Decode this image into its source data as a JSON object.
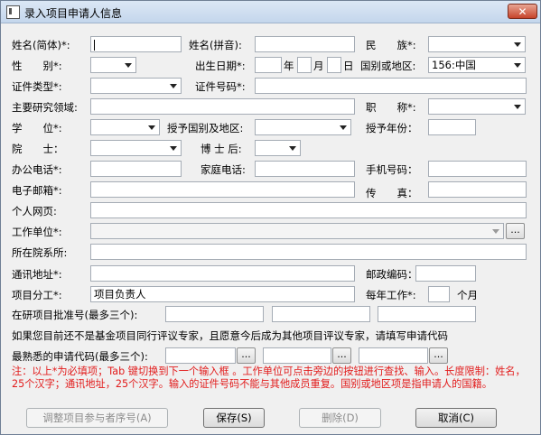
{
  "window": {
    "title": "录入项目申请人信息",
    "close_label": "✕"
  },
  "labels": {
    "name_cn": "姓名(简体)*:",
    "name_py": "姓名(拼音):",
    "nation": "民　　族*:",
    "gender": "性　　别*:",
    "birth": "出生日期*:",
    "year": "年",
    "month": "月",
    "day": "日",
    "country": "国别或地区:",
    "id_type": "证件类型*:",
    "id_no": "证件号码*:",
    "research": "主要研究领域:",
    "title": "职　　称*:",
    "degree": "学　　位*:",
    "degree_country": "授予国别及地区:",
    "degree_year": "授予年份：",
    "academician": "院　　士：",
    "postdoc": "博 士 后:",
    "office_phone": "办公电话*:",
    "home_phone": "家庭电话:",
    "mobile": "手机号码：",
    "email": "电子邮箱*:",
    "fax": "传　　真：",
    "homepage": "个人网页:",
    "employer": "工作单位*:",
    "department": "所在院系所:",
    "address": "通讯地址*:",
    "postcode": "邮政编码：",
    "division": "项目分工*:",
    "work_per_year": "每年工作*:",
    "months": "个月",
    "approved": "在研项目批准号(最多三个):",
    "notice": "如果您目前还不是基金项目同行评议专家，且愿意今后成为其他项目评议专家，请填写申请代码",
    "codes": "最熟悉的申请代码(最多三个):"
  },
  "values": {
    "country": "156:中国",
    "division": "项目负责人"
  },
  "dots_label": "...",
  "note_text": "注：以上*为必填项；Tab 键切换到下一个输入框 。工作单位可点击旁边的按钮进行查找、输入。长度限制：姓名，25个汉字；通讯地址，25个汉字。输入的证件号码不能与其他成员重复。国别或地区项是指申请人的国籍。",
  "buttons": {
    "adjust": "调整项目参与者序号(A)",
    "save": "保存(S)",
    "delete": "删除(D)",
    "cancel": "取消(C)"
  }
}
